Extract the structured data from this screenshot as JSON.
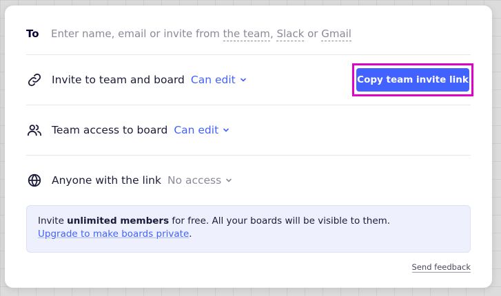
{
  "share_dialog": {
    "to_label": "To",
    "to_placeholder_prefix": "Enter name, email or invite from ",
    "to_link_team": "the team",
    "to_sep1": ", ",
    "to_link_slack": "Slack",
    "to_sep2": " or ",
    "to_link_gmail": "Gmail",
    "rows": [
      {
        "icon": "link-icon",
        "label": "Invite to team and board",
        "permission": "Can edit"
      },
      {
        "icon": "people-icon",
        "label": "Team access to board",
        "permission": "Can edit"
      },
      {
        "icon": "globe-icon",
        "label": "Anyone with the link",
        "permission": "No access"
      }
    ],
    "copy_button_label": "Copy team invite link",
    "info": {
      "text_1": "Invite ",
      "bold": "unlimited members",
      "text_2": " for free. All your boards will be visible to them.",
      "link": "Upgrade to make boards private",
      "link_suffix": "."
    },
    "feedback_label": "Send feedback"
  },
  "colors": {
    "accent": "#4262ff",
    "highlight": "#e100c8",
    "text": "#1c1c3a",
    "muted": "#8a8a99"
  }
}
